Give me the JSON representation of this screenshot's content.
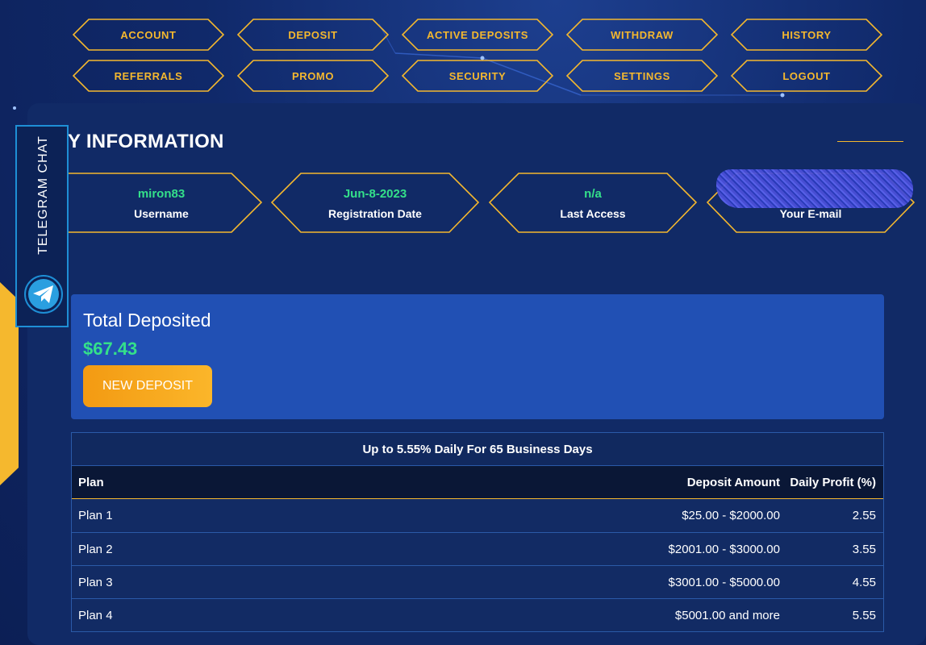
{
  "nav": {
    "row1": [
      "ACCOUNT",
      "DEPOSIT",
      "ACTIVE DEPOSITS",
      "WITHDRAW",
      "HISTORY"
    ],
    "row2": [
      "REFERRALS",
      "PROMO",
      "SECURITY",
      "SETTINGS",
      "LOGOUT"
    ]
  },
  "page_title": "Y INFORMATION",
  "telegram": {
    "label": "TELEGRAM CHAT",
    "icon": "telegram-icon"
  },
  "info": [
    {
      "value": "miron83",
      "label": "Username"
    },
    {
      "value": "Jun-8-2023",
      "label": "Registration Date"
    },
    {
      "value": "n/a",
      "label": "Last Access"
    },
    {
      "value": "",
      "label": "Your E-mail"
    }
  ],
  "total": {
    "title": "Total Deposited",
    "amount": "$67.43",
    "button": "NEW DEPOSIT"
  },
  "plans": {
    "caption": "Up to 5.55% Daily For 65 Business Days",
    "headers": [
      "Plan",
      "Deposit Amount",
      "Daily Profit (%)"
    ],
    "rows": [
      [
        "Plan 1",
        "$25.00 - $2000.00",
        "2.55"
      ],
      [
        "Plan 2",
        "$2001.00 - $3000.00",
        "3.55"
      ],
      [
        "Plan 3",
        "$3001.00 - $5000.00",
        "4.55"
      ],
      [
        "Plan 4",
        "$5001.00 and more",
        "5.55"
      ]
    ]
  },
  "colors": {
    "accent": "#f5b82e",
    "value_green": "#34e08a",
    "panel": "#112a66",
    "total_box": "#2150b4",
    "telegram_border": "#1e8fd6"
  }
}
